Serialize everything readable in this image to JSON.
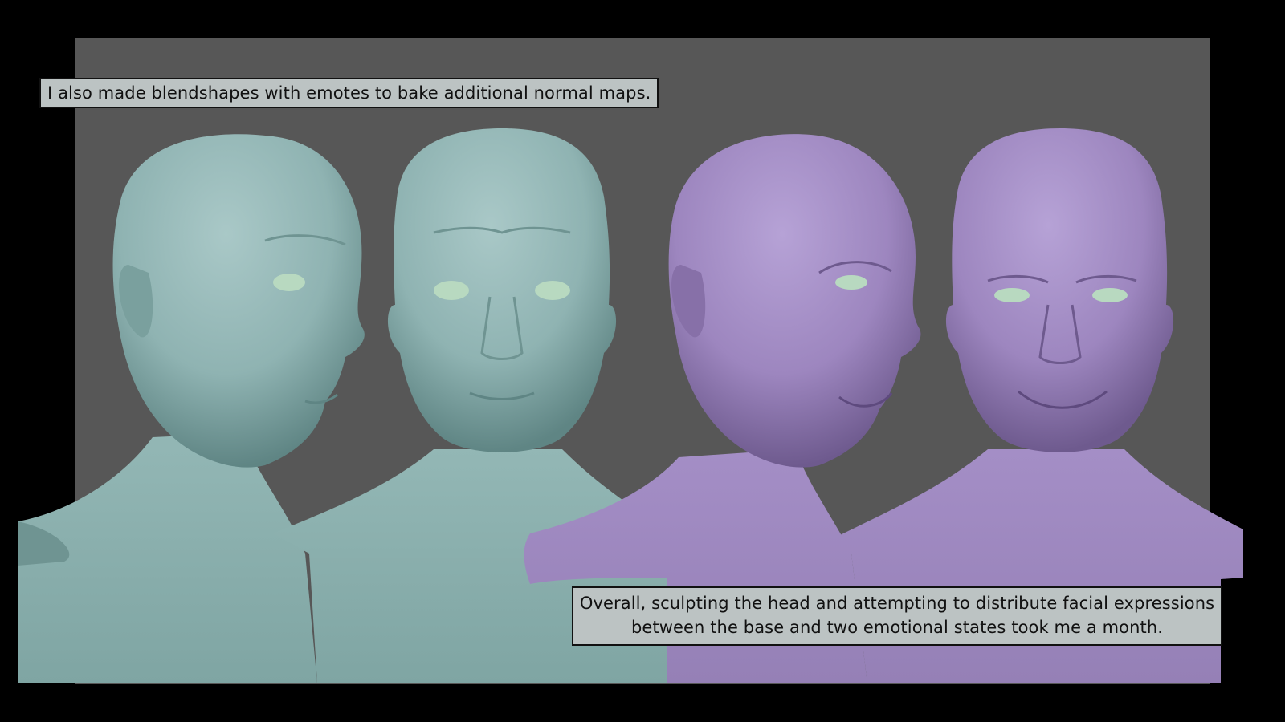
{
  "captions": {
    "top": "I also made blendshapes with emotes to bake additional normal maps.",
    "bottom_line1": "Overall, sculpting the head and attempting to distribute facial expressions",
    "bottom_line2": "between the base and two emotional states took me a month."
  },
  "colors": {
    "background": "#000000",
    "panel": "#575757",
    "neutral_sculpt": "#8fb3b2",
    "emotion_sculpt": "#9d86bf",
    "eyes": "#b8d9c0",
    "caption_box": "#bcc3c3"
  },
  "sculpts": [
    {
      "icon": "head-sculpt-neutral-side-icon"
    },
    {
      "icon": "head-sculpt-neutral-front-icon"
    },
    {
      "icon": "head-sculpt-smile-side-icon"
    },
    {
      "icon": "head-sculpt-smile-front-icon"
    }
  ]
}
